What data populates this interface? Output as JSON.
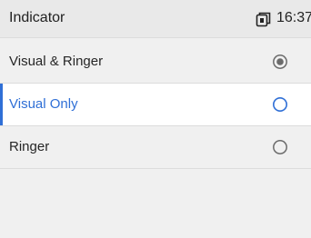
{
  "header": {
    "title": "Indicator",
    "time": "16:37",
    "device_icon": "phone-handset-icon"
  },
  "options": [
    {
      "label": "Visual & Ringer",
      "checked": true,
      "highlighted": false
    },
    {
      "label": "Visual Only",
      "checked": false,
      "highlighted": true
    },
    {
      "label": "Ringer",
      "checked": false,
      "highlighted": false
    }
  ],
  "colors": {
    "accent": "#2f6fd6",
    "text": "#262626",
    "radio_gray": "#6b6b6b"
  }
}
